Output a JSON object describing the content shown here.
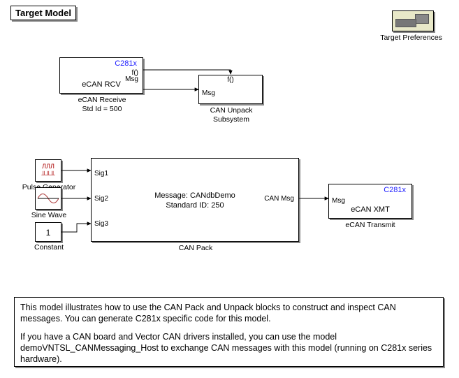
{
  "title": "Target Model",
  "target_prefs_label": "Target Preferences",
  "ecan_rcv": {
    "c281x": "C281x",
    "inner": "eCAN RCV",
    "label1": "eCAN Receive",
    "label2": "Std Id = 500",
    "port_f": "f()",
    "port_msg": "Msg"
  },
  "can_unpack": {
    "f": "f()",
    "msg": "Msg",
    "label1": "CAN Unpack",
    "label2": "Subsystem"
  },
  "can_pack": {
    "sig1": "Sig1",
    "sig2": "Sig2",
    "sig3": "Sig3",
    "out": "CAN Msg",
    "msg1": "Message: CANdbDemo",
    "msg2": "Standard ID: 250",
    "label": "CAN Pack"
  },
  "ecan_xmt": {
    "c281x": "C281x",
    "inner": "eCAN XMT",
    "label": "eCAN Transmit",
    "msg": "Msg"
  },
  "sources": {
    "pulse_label": "Pulse Generator",
    "sine_label": "Sine Wave",
    "constant_label": "Constant",
    "constant_value": "1"
  },
  "description": {
    "p1": "This model illustrates how to use the CAN Pack and Unpack blocks to construct and inspect CAN messages. You can generate C281x specific code for this model.",
    "p2": "If you have a CAN board and Vector CAN drivers installed, you can use the model demoVNTSL_CANMessaging_Host to exchange CAN messages with this model (running on C281x series hardware)."
  }
}
